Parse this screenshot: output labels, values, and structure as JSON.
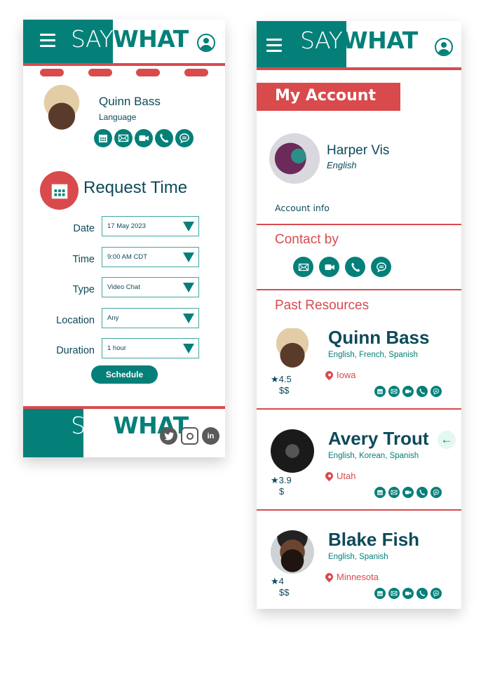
{
  "brand": {
    "say": "SAY",
    "what": "WHAT",
    "teal": "#048079",
    "red": "#d94a4d",
    "navy": "#0d4a5a"
  },
  "request_screen": {
    "profile": {
      "name": "Quinn Bass",
      "subtitle": "Language"
    },
    "contact_icons": [
      "calendar-icon",
      "mail-icon",
      "video-icon",
      "phone-icon",
      "chat-icon"
    ],
    "title": "Request Time",
    "form": [
      {
        "label": "Date",
        "value": "17 May 2023"
      },
      {
        "label": "Time",
        "value": "9:00 AM CDT"
      },
      {
        "label": "Type",
        "value": "Video Chat"
      },
      {
        "label": "Location",
        "value": "Any"
      },
      {
        "label": "Duration",
        "value": "1 hour"
      }
    ],
    "schedule_label": "Schedule",
    "social": {
      "twitter": "twitter-icon",
      "instagram": "instagram-icon",
      "linkedin": "in"
    }
  },
  "account_screen": {
    "banner": "My Account",
    "user": {
      "name": "Harper Vis",
      "language": "English"
    },
    "account_info": "Account info",
    "contact_title": "Contact by",
    "contact_icons": [
      "mail-icon",
      "video-icon",
      "phone-icon",
      "chat-icon"
    ],
    "past_title": "Past Resources",
    "resources": [
      {
        "name": "Quinn Bass",
        "languages": "English, French, Spanish",
        "location": "Iowa",
        "rating": "★4.5",
        "price": "$$"
      },
      {
        "name": "Avery Trout",
        "languages": "English, Korean, Spanish",
        "location": "Utah",
        "rating": "★3.9",
        "price": "$",
        "back": "←"
      },
      {
        "name": "Blake Fish",
        "languages": "English, Spanish",
        "location": "Minnesota",
        "rating": "★4",
        "price": "$$"
      }
    ]
  }
}
